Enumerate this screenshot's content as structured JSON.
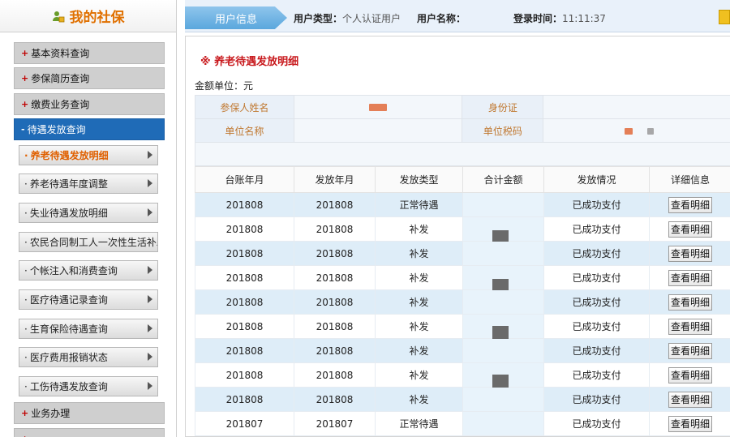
{
  "sidebar": {
    "title": "我的社保",
    "menu": [
      {
        "label": "基本资料查询"
      },
      {
        "label": "参保简历查询"
      },
      {
        "label": "缴费业务查询"
      },
      {
        "label": "待遇发放查询"
      }
    ],
    "submenu": [
      {
        "label": "养老待遇发放明细"
      },
      {
        "label": "养老待遇年度调整"
      },
      {
        "label": "失业待遇发放明细"
      },
      {
        "label": "农民合同制工人一次性生活补助"
      },
      {
        "label": "个帐注入和消费查询"
      },
      {
        "label": "医疗待遇记录查询"
      },
      {
        "label": "生育保险待遇查询"
      },
      {
        "label": "医疗费用报销状态"
      },
      {
        "label": "工伤待遇发放查询"
      }
    ],
    "menu_bottom": [
      {
        "label": "业务办理"
      }
    ]
  },
  "header": {
    "tab": "用户信息",
    "user_type_label": "用户类型：",
    "user_type_value": "个人认证用户",
    "user_name_label": "用户名称：",
    "login_time_label": "登录时间：",
    "login_time_value": "11:11:37"
  },
  "section": {
    "title": "※ 养老待遇发放明细",
    "unit": "金额单位：元"
  },
  "info": {
    "name_label": "参保人姓名",
    "id_label": "身份证",
    "company_label": "单位名称",
    "tax_label": "单位税码"
  },
  "table": {
    "headers": [
      "台账年月",
      "发放年月",
      "发放类型",
      "合计金额",
      "发放情况",
      "详细信息"
    ],
    "rows": [
      [
        "201808",
        "201808",
        "正常待遇",
        "",
        "已成功支付",
        "查看明细"
      ],
      [
        "201808",
        "201808",
        "补发",
        "",
        "已成功支付",
        "查看明细"
      ],
      [
        "201808",
        "201808",
        "补发",
        "",
        "已成功支付",
        "查看明细"
      ],
      [
        "201808",
        "201808",
        "补发",
        "",
        "已成功支付",
        "查看明细"
      ],
      [
        "201808",
        "201808",
        "补发",
        "",
        "已成功支付",
        "查看明细"
      ],
      [
        "201808",
        "201808",
        "补发",
        "",
        "已成功支付",
        "查看明细"
      ],
      [
        "201808",
        "201808",
        "补发",
        "",
        "已成功支付",
        "查看明细"
      ],
      [
        "201808",
        "201808",
        "补发",
        "",
        "已成功支付",
        "查看明细"
      ],
      [
        "201808",
        "201808",
        "补发",
        "",
        "已成功支付",
        "查看明细"
      ],
      [
        "201807",
        "201807",
        "正常待遇",
        "",
        "已成功支付",
        "查看明细"
      ]
    ]
  },
  "colors": {
    "accent_orange": "#e07000",
    "active_blue": "#1f6bb7",
    "title_red": "#c8181c",
    "row_blue": "#deedf8"
  }
}
